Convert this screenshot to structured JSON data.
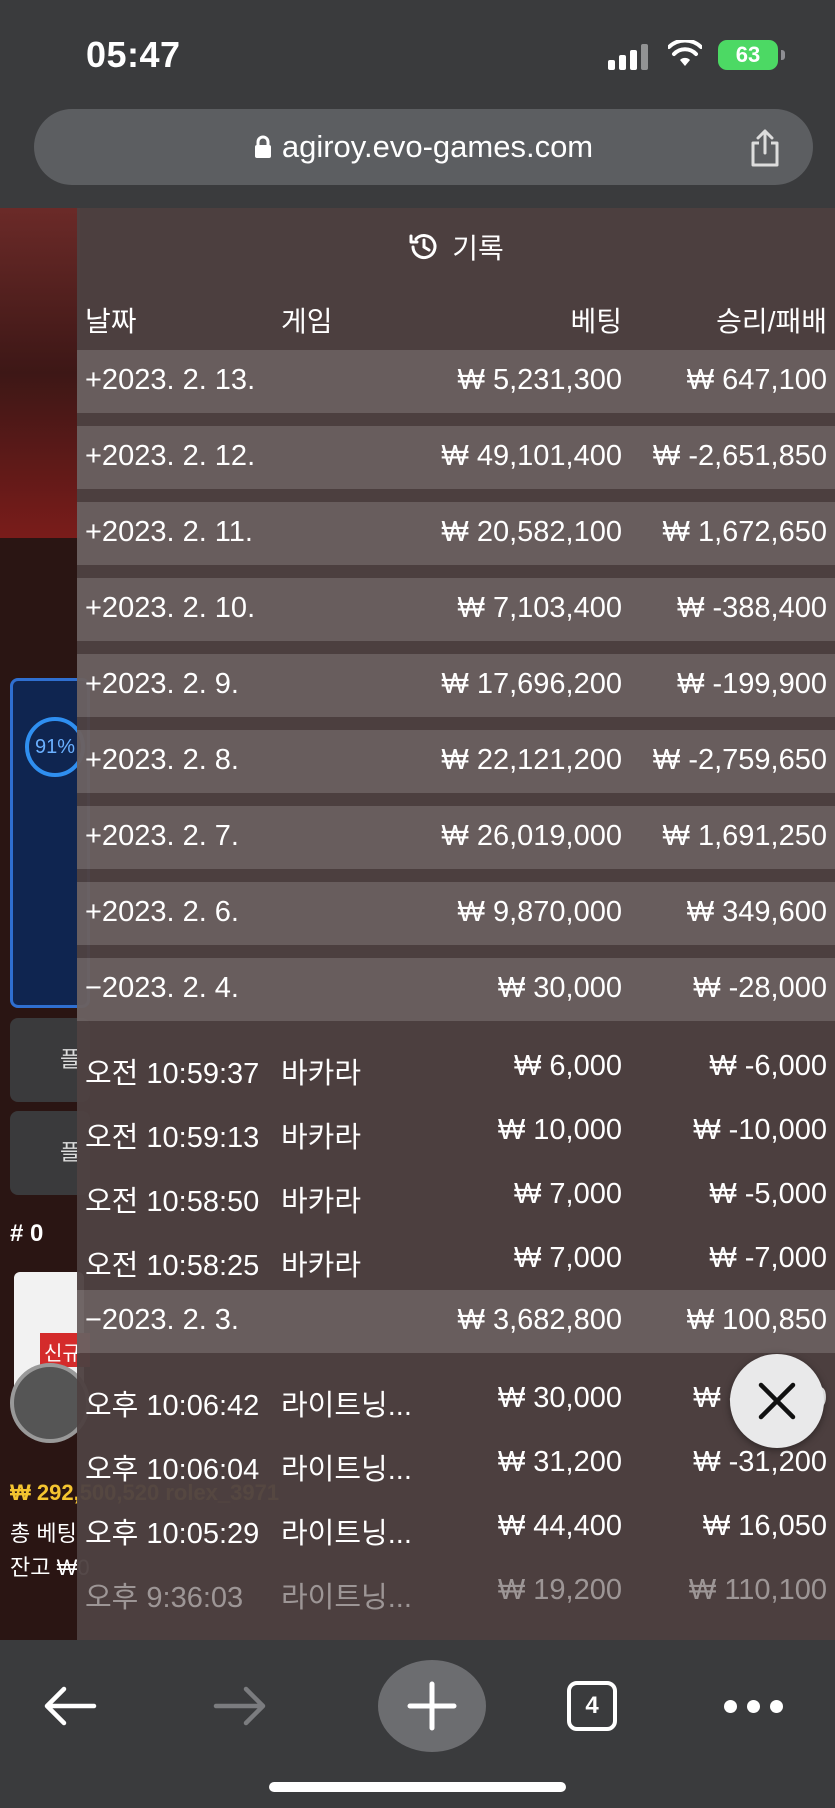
{
  "status_bar": {
    "time": "05:47",
    "battery": "63"
  },
  "browser": {
    "url": "agiroy.evo-games.com",
    "tab_count": "4"
  },
  "background_page": {
    "percent": "91%",
    "button_label_1": "플",
    "button_label_2": "플",
    "count_label": "# 0",
    "new_tag": "신규",
    "info_line_1": "₩ 292,500,520  rolex_3971",
    "info_line_2": "총 베팅",
    "info_line_3": "잔고 ₩0"
  },
  "history": {
    "title": "기록",
    "columns": {
      "date": "날짜",
      "game": "게임",
      "bet": "베팅",
      "winloss": "승리/패배"
    },
    "rows": [
      {
        "kind": "day",
        "date": "+2023. 2. 13.",
        "game": "",
        "bet": "₩ 5,231,300",
        "winloss": "₩ 647,100"
      },
      {
        "kind": "day",
        "date": "+2023. 2. 12.",
        "game": "",
        "bet": "₩ 49,101,400",
        "winloss": "₩ -2,651,850"
      },
      {
        "kind": "day",
        "date": "+2023. 2. 11.",
        "game": "",
        "bet": "₩ 20,582,100",
        "winloss": "₩ 1,672,650"
      },
      {
        "kind": "day",
        "date": "+2023. 2. 10.",
        "game": "",
        "bet": "₩ 7,103,400",
        "winloss": "₩ -388,400"
      },
      {
        "kind": "day",
        "date": "+2023. 2. 9.",
        "game": "",
        "bet": "₩ 17,696,200",
        "winloss": "₩ -199,900"
      },
      {
        "kind": "day",
        "date": "+2023. 2. 8.",
        "game": "",
        "bet": "₩ 22,121,200",
        "winloss": "₩ -2,759,650"
      },
      {
        "kind": "day",
        "date": "+2023. 2. 7.",
        "game": "",
        "bet": "₩ 26,019,000",
        "winloss": "₩ 1,691,250"
      },
      {
        "kind": "day",
        "date": "+2023. 2. 6.",
        "game": "",
        "bet": "₩ 9,870,000",
        "winloss": "₩ 349,600"
      },
      {
        "kind": "day",
        "date": "−2023. 2. 4.",
        "game": "",
        "bet": "₩ 30,000",
        "winloss": "₩ -28,000"
      },
      {
        "kind": "detail",
        "date": "오전 10:59:37",
        "game": "바카라",
        "bet": "₩ 6,000",
        "winloss": "₩ -6,000"
      },
      {
        "kind": "detail",
        "date": "오전 10:59:13",
        "game": "바카라",
        "bet": "₩ 10,000",
        "winloss": "₩ -10,000"
      },
      {
        "kind": "detail",
        "date": "오전 10:58:50",
        "game": "바카라",
        "bet": "₩ 7,000",
        "winloss": "₩ -5,000"
      },
      {
        "kind": "detail",
        "date": "오전 10:58:25",
        "game": "바카라",
        "bet": "₩ 7,000",
        "winloss": "₩ -7,000"
      },
      {
        "kind": "day",
        "date": "−2023. 2. 3.",
        "game": "",
        "bet": "₩ 3,682,800",
        "winloss": "₩ 100,850"
      },
      {
        "kind": "detail",
        "date": "오후 10:06:42",
        "game": "라이트닝...",
        "bet": "₩ 30,000",
        "winloss": "₩ -30,000"
      },
      {
        "kind": "detail",
        "date": "오후 10:06:04",
        "game": "라이트닝...",
        "bet": "₩ 31,200",
        "winloss": "₩ -31,200"
      },
      {
        "kind": "detail",
        "date": "오후 10:05:29",
        "game": "라이트닝...",
        "bet": "₩ 44,400",
        "winloss": "₩ 16,050"
      },
      {
        "kind": "detail",
        "date": "오후 9:36:03",
        "game": "라이트닝...",
        "bet": "₩ 19,200",
        "winloss": "₩ 110,100",
        "faded": true
      }
    ]
  }
}
